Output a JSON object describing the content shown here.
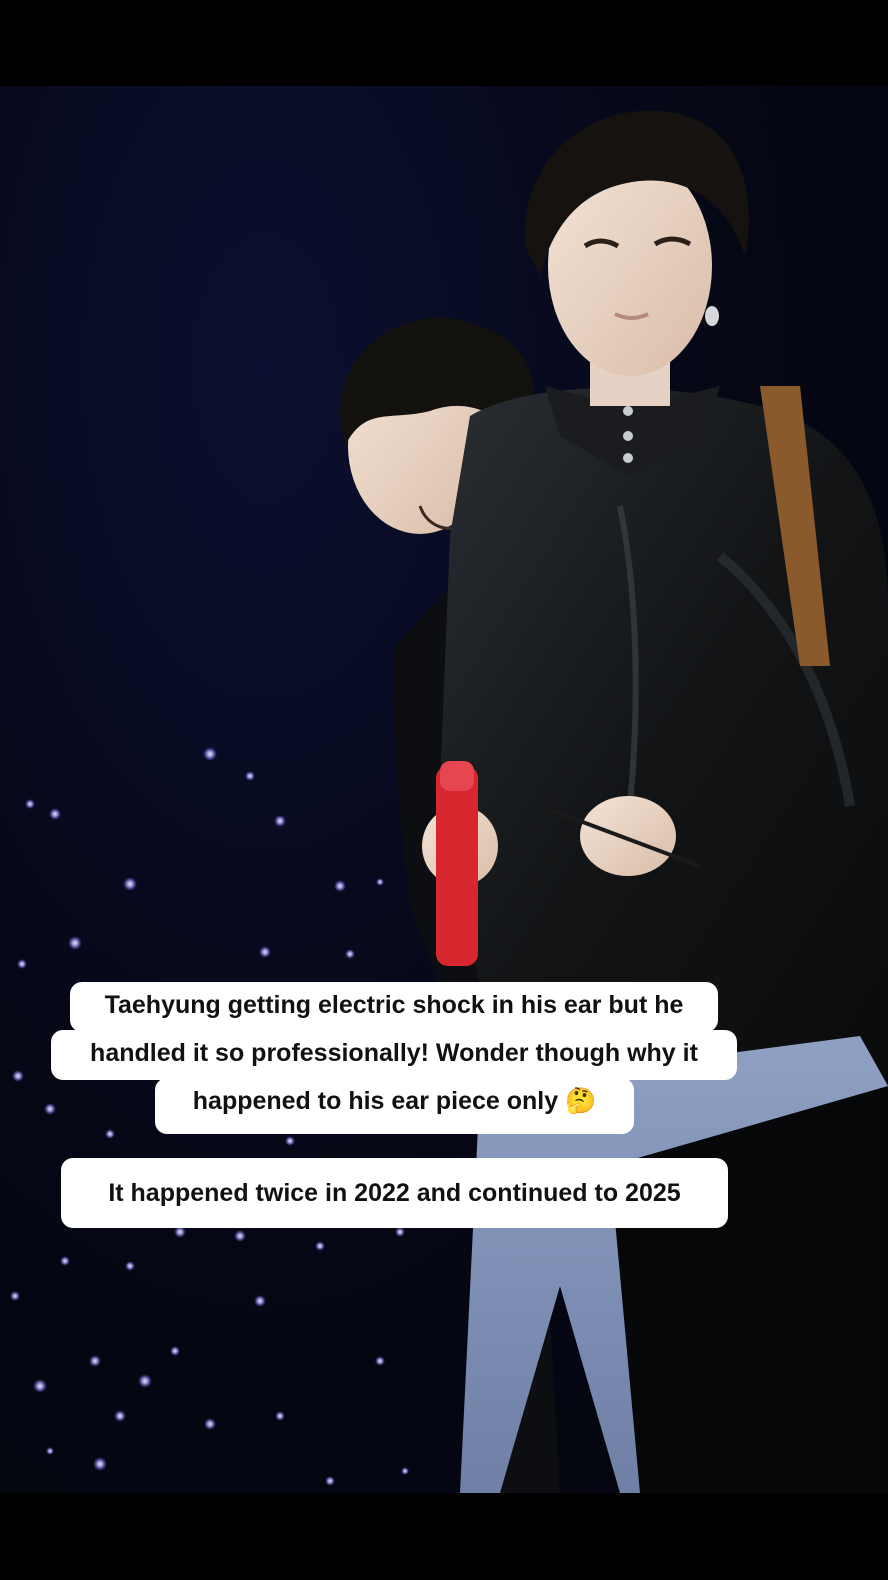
{
  "video": {
    "description_scene": "concert-stage"
  },
  "captions": {
    "first": {
      "line1": "Taehyung getting electric shock in his ear but he",
      "line2": "handled it so professionally! Wonder though why it",
      "line3": "happened to his ear piece only 🤔"
    },
    "second": {
      "line1": "It happened twice in 2022 and continued to 2025"
    }
  },
  "colors": {
    "background": "#000000",
    "caption_bg": "#ffffff",
    "caption_text": "#111111",
    "stage_dark": "#050714",
    "light_stick_purple": "#9b8cff",
    "microphone_red": "#d8262f",
    "jacket_black": "#141618",
    "strap_brown": "#8a5a2c"
  }
}
